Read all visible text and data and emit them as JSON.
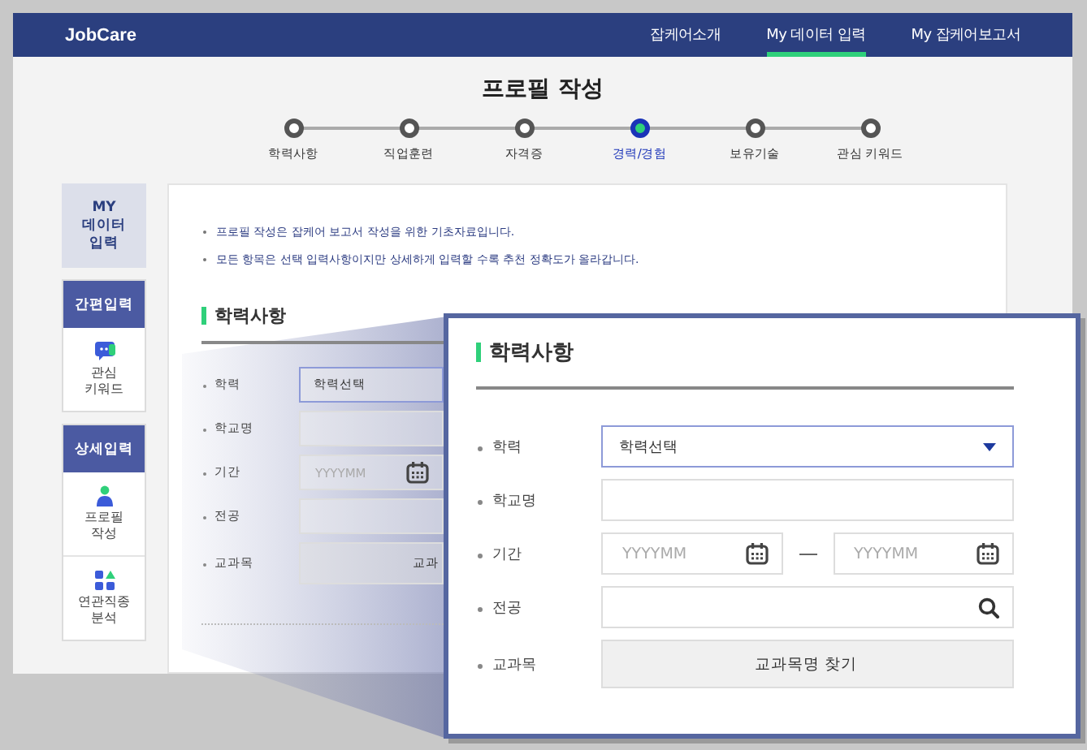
{
  "header": {
    "logo": "JobCare",
    "nav": [
      {
        "label": "잡케어소개",
        "selected": false
      },
      {
        "label": "My 데이터 입력",
        "selected": true
      },
      {
        "label": "My 잡케어보고서",
        "selected": false
      }
    ]
  },
  "page_title": "프로필 작성",
  "steps": [
    {
      "label": "학력사항",
      "selected": false
    },
    {
      "label": "직업훈련",
      "selected": false
    },
    {
      "label": "자격증",
      "selected": false
    },
    {
      "label": "경력/경험",
      "selected": true
    },
    {
      "label": "보유기술",
      "selected": false
    },
    {
      "label": "관심 키워드",
      "selected": false
    }
  ],
  "sidebar": {
    "title": "MY 데이터 입력",
    "groups": [
      {
        "title": "간편입력",
        "items": [
          {
            "label": "관심 키워드"
          }
        ]
      },
      {
        "title": "상세입력",
        "items": [
          {
            "label": "프로필 작성"
          },
          {
            "label": "연관직종 분석"
          }
        ]
      }
    ]
  },
  "notes": [
    "프로필 작성은 잡케어 보고서 작성을 위한 기초자료입니다.",
    "모든 항목은 선택 입력사항이지만 상세하게 입력할 수록 추천 정확도가 올라갑니다."
  ],
  "form": {
    "section_title": "학력사항",
    "rows": [
      {
        "label": "학력",
        "kind": "select",
        "value": "학력선택"
      },
      {
        "label": "학교명",
        "kind": "text"
      },
      {
        "label": "기간",
        "kind": "period",
        "placeholders": [
          "YYYYMM"
        ]
      },
      {
        "label": "전공",
        "kind": "text"
      },
      {
        "label": "교과목",
        "kind": "button",
        "text": "교과"
      }
    ]
  },
  "callout": {
    "section_title": "학력사항",
    "rows": [
      {
        "label": "학력",
        "kind": "select",
        "value": "학력선택"
      },
      {
        "label": "학교명",
        "kind": "text"
      },
      {
        "label": "기간",
        "kind": "period",
        "placeholders": [
          "YYYYMM",
          "YYYYMM"
        ]
      },
      {
        "label": "전공",
        "kind": "search"
      },
      {
        "label": "교과목",
        "kind": "button",
        "text": "교과목명 찾기"
      }
    ]
  }
}
